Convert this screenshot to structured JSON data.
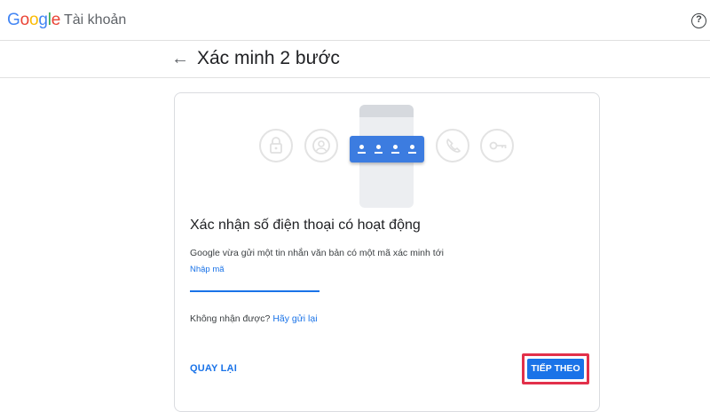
{
  "app": {
    "logo_letters": [
      "G",
      "o",
      "o",
      "g",
      "l",
      "e"
    ],
    "logo_colors": [
      "#4285F4",
      "#EA4335",
      "#FBBC05",
      "#4285F4",
      "#34A853",
      "#EA4335"
    ],
    "product_name": "Tài khoản",
    "help_glyph": "?"
  },
  "header": {
    "back_glyph": "←",
    "title": "Xác minh 2 bước"
  },
  "card": {
    "icons": [
      "lock-icon",
      "person-icon",
      "phone-icon",
      "key-icon"
    ],
    "code_dots": 4,
    "heading": "Xác nhận số điện thoại có hoạt động",
    "description": "Google vừa gửi một tin nhắn văn bản có một mã xác minh tới",
    "input_label": "Nhập mã",
    "input_value": "",
    "resend_prompt": "Không nhận được?",
    "resend_link": "Hãy gửi lại",
    "back_button": "QUAY LẠI",
    "next_button": "TIẾP THEO",
    "highlight_color": "#e2304a",
    "accent_color": "#1a73e8"
  }
}
